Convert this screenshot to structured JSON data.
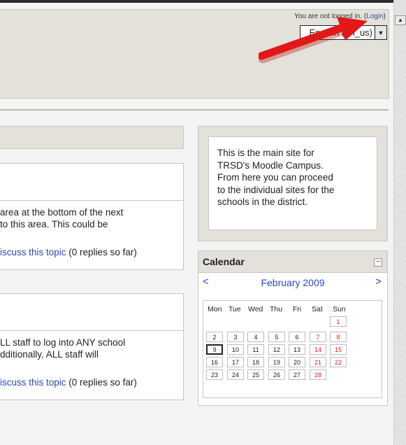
{
  "header": {
    "login_prefix": "You are not logged in. (",
    "login_link": "Login",
    "login_suffix": ")",
    "language": "English (en_us)"
  },
  "posts": [
    {
      "body": [
        "area at the bottom of the next",
        " to this area.  This could be"
      ],
      "link": "iscuss this topic",
      "replies": " (0 replies so far)"
    },
    {
      "body": [
        "LL staff to log into ANY school",
        "dditionally, ALL staff will"
      ],
      "link": "iscuss this topic",
      "replies": " (0 replies so far)"
    }
  ],
  "info_text": "This is the main site for\nTRSD's Moodle Campus.\nFrom here you can proceed\nto the individual sites for the\nschools in the district.",
  "calendar": {
    "title": "Calendar",
    "month": "February 2009",
    "prev": "<",
    "next": ">",
    "days_of_week": [
      "Mon",
      "Tue",
      "Wed",
      "Thu",
      "Fri",
      "Sat",
      "Sun"
    ],
    "weeks": [
      [
        "",
        "",
        "",
        "",
        "",
        "",
        "1"
      ],
      [
        "2",
        "3",
        "4",
        "5",
        "6",
        "7",
        "8"
      ],
      [
        "9",
        "10",
        "11",
        "12",
        "13",
        "14",
        "15"
      ],
      [
        "16",
        "17",
        "18",
        "19",
        "20",
        "21",
        "22"
      ],
      [
        "23",
        "24",
        "25",
        "26",
        "27",
        "28",
        ""
      ]
    ],
    "today": "9"
  },
  "icons": {
    "select_arrow": "dropdown-arrow-icon",
    "scroll_up": "scroll-up-arrow-icon",
    "annotation": "red-arrow-icon",
    "collapse": "minus-box-icon"
  },
  "colors": {
    "link": "#2a4bb5",
    "weekend": "#e12020",
    "header_bg": "#e3e1d9",
    "annotation_arrow": "#e01818"
  }
}
